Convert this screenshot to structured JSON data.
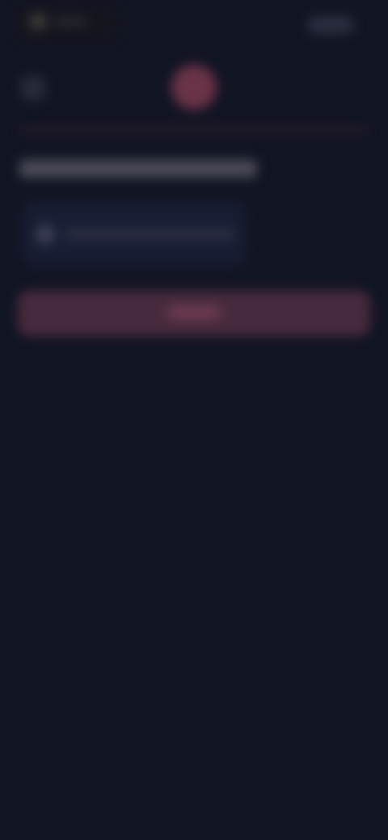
{
  "app": {
    "background": "#121524",
    "accent": "#6a3347"
  },
  "topbar": {
    "logo_icon": "app-logo-icon",
    "right_pill": "pill-button"
  },
  "header": {
    "back_icon": "chevron-left-icon",
    "avatar": "avatar-icon"
  },
  "card": {
    "icon": "info-icon"
  },
  "cta": {
    "style": "primary"
  }
}
